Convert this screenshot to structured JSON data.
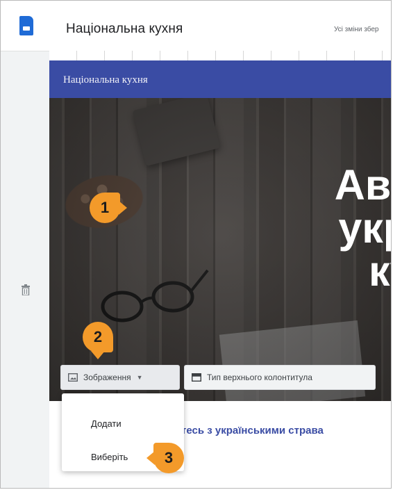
{
  "app": {
    "site_title": "Національна кухня",
    "save_status": "Усі зміни збер"
  },
  "page": {
    "header_band_title": "Національна кухня",
    "hero_heading": [
      "Автент",
      "україн",
      "кухн"
    ],
    "subtitle": "тесь з українськими страва"
  },
  "toolbar": {
    "image_button_label": "Зображення",
    "header_type_button_label": "Тип верхнього колонтитула"
  },
  "image_menu": {
    "items": [
      "Додати",
      "Виберіть"
    ]
  },
  "callouts": [
    "1",
    "2",
    "3"
  ],
  "colors": {
    "accent_blue": "#3a4ca4",
    "callout_orange": "#f39a2a",
    "doc_icon_blue": "#1f6bd6"
  },
  "icons": {
    "app": "sites-doc-icon",
    "delete": "trash-icon",
    "image": "image-icon",
    "header_type": "header-layout-icon",
    "dropdown": "caret-down-icon"
  }
}
